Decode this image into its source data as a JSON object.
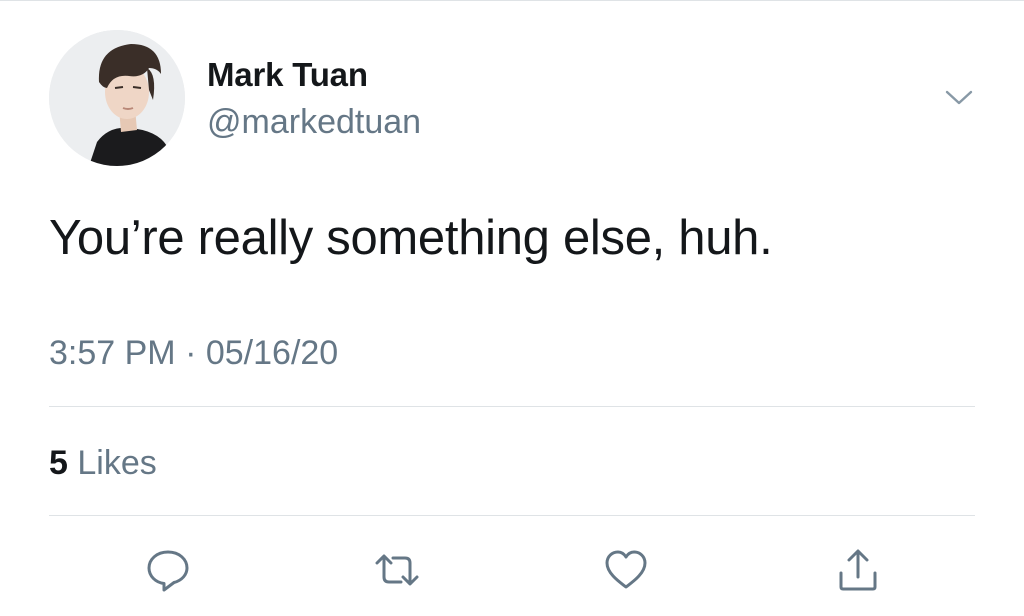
{
  "tweet": {
    "author": {
      "display_name": "Mark Tuan",
      "handle": "@markedtuan"
    },
    "text": "You’re really something else, huh.",
    "time": "3:57 PM",
    "separator": "·",
    "date": "05/16/20",
    "likes": {
      "count": "5",
      "label": "Likes"
    }
  },
  "icons": {
    "menu": "chevron-down-icon",
    "reply": "reply-icon",
    "retweet": "retweet-icon",
    "like": "heart-icon",
    "share": "share-icon"
  },
  "colors": {
    "primary_text": "#14171a",
    "secondary_text": "#657786",
    "divider": "#dfe3e6",
    "icon": "#657786"
  }
}
